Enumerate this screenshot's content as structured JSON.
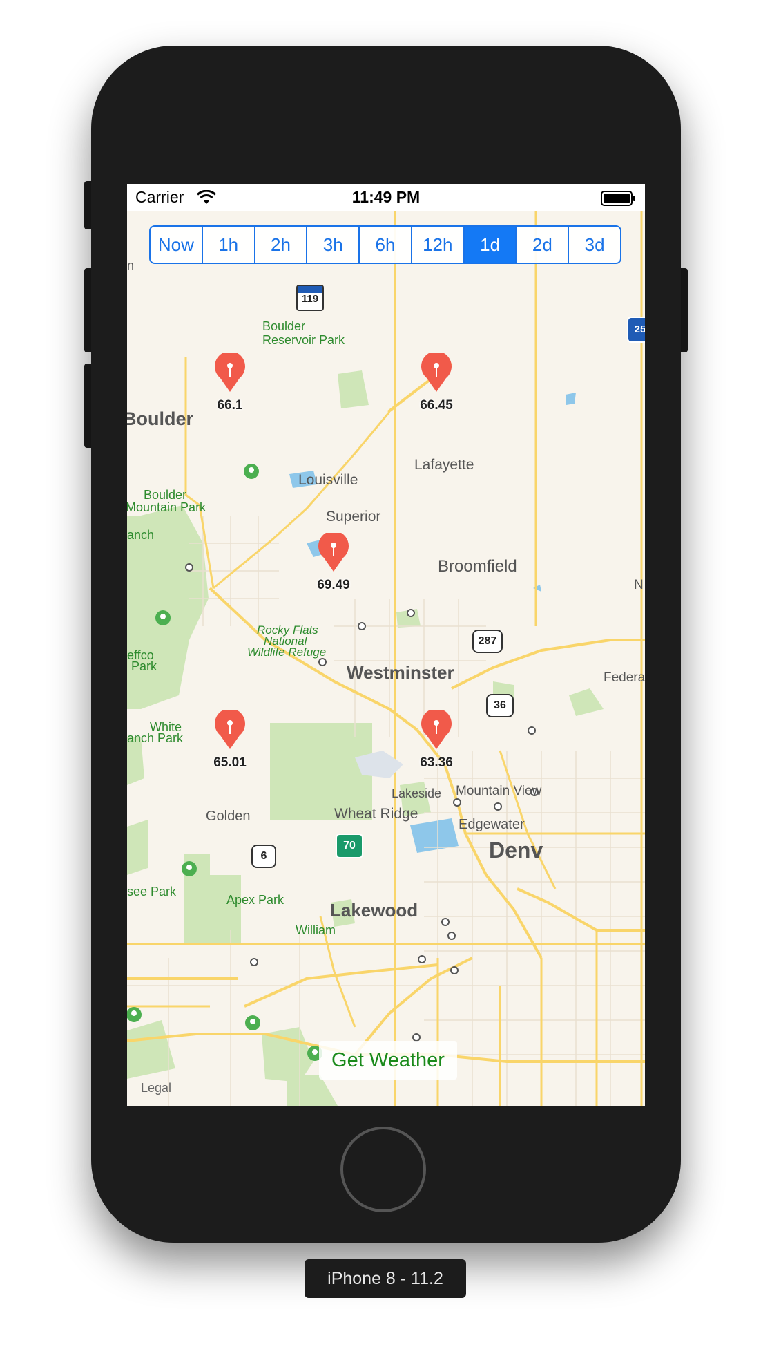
{
  "device_label": "iPhone 8 - 11.2",
  "status_bar": {
    "carrier": "Carrier",
    "time": "11:49 PM"
  },
  "time_selector": {
    "options": [
      "Now",
      "1h",
      "2h",
      "3h",
      "6h",
      "12h",
      "1d",
      "2d",
      "3d"
    ],
    "selected": "1d"
  },
  "pins": [
    {
      "value": "66.1"
    },
    {
      "value": "66.45"
    },
    {
      "value": "69.49"
    },
    {
      "value": "65.01"
    },
    {
      "value": "63.36"
    }
  ],
  "map_labels": {
    "boulder": "Boulder",
    "boulder_reservoir_1": "Boulder",
    "boulder_reservoir_2": "Reservoir Park",
    "lafayette": "Lafayette",
    "louisville": "Louisville",
    "superior": "Superior",
    "broomfield": "Broomfield",
    "boulder_mountain_1": "Boulder",
    "boulder_mountain_2": "Mountain Park",
    "ranch_partial": "anch",
    "rocky_flats_1": "Rocky Flats",
    "rocky_flats_2": "National",
    "rocky_flats_3": "Wildlife Refuge",
    "jeffco_1": "effco",
    "jeffco_2": "Park",
    "westminster": "Westminster",
    "federal": "Federa",
    "white_ranch_1": "White",
    "white_ranch_2": "anch Park",
    "lakeside": "Lakeside",
    "mountain_view": "Mountain View",
    "golden": "Golden",
    "wheat_ridge": "Wheat Ridge",
    "edgewater": "Edgewater",
    "denver": "Denv",
    "apex_park": "Apex Park",
    "see_park": "see Park",
    "lakewood": "Lakewood",
    "partial_n": "n",
    "partial_N": "N",
    "william": "William"
  },
  "highway_shields": {
    "co119": "119",
    "i25": "25",
    "us287": "287",
    "us36": "36",
    "i70": "70",
    "us6": "6"
  },
  "get_weather_label": "Get Weather",
  "legal_label": "Legal",
  "colors": {
    "accent": "#1a73e8",
    "segment_selected": "#1479f5",
    "pin": "#f15a4a",
    "park": "#cfe6b8",
    "road": "#f9d56a",
    "water": "#8ec7ea",
    "map_bg": "#f8f4ec",
    "get_weather_text": "#1a8a1a"
  }
}
